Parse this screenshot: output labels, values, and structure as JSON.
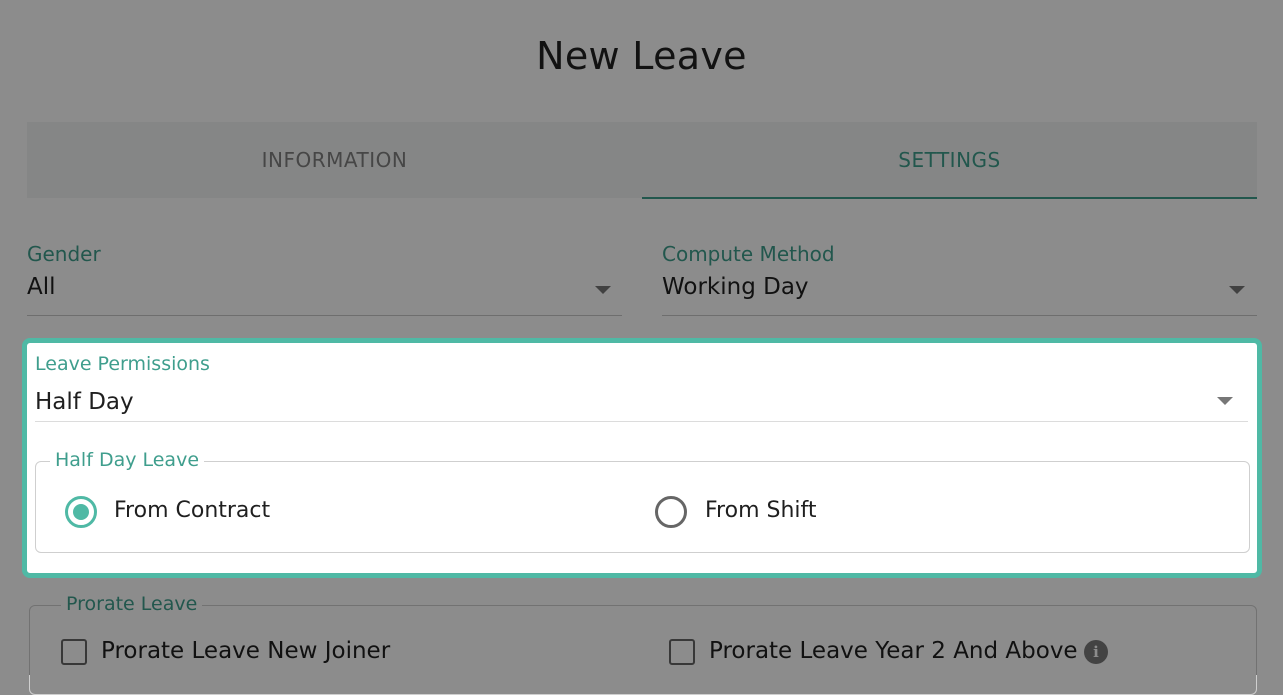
{
  "page": {
    "title": "New Leave"
  },
  "tabs": [
    {
      "label": "INFORMATION",
      "active": false
    },
    {
      "label": "SETTINGS",
      "active": true
    }
  ],
  "gender": {
    "label": "Gender",
    "value": "All"
  },
  "compute_method": {
    "label": "Compute Method",
    "value": "Working Day"
  },
  "leave_permissions": {
    "label": "Leave Permissions",
    "value": "Half Day",
    "half_day_leave": {
      "legend": "Half Day Leave",
      "options": [
        {
          "label": "From Contract",
          "selected": true
        },
        {
          "label": "From Shift",
          "selected": false
        }
      ]
    }
  },
  "prorate_leave": {
    "legend": "Prorate Leave",
    "options": [
      {
        "label": "Prorate Leave New Joiner",
        "checked": false
      },
      {
        "label": "Prorate Leave Year 2 And Above",
        "checked": false,
        "info_icon": "info-icon"
      }
    ]
  },
  "colors": {
    "accent": "#4fb9a5",
    "accent_text": "#3f9e8d",
    "overlay": "rgba(0,0,0,0.45)"
  }
}
